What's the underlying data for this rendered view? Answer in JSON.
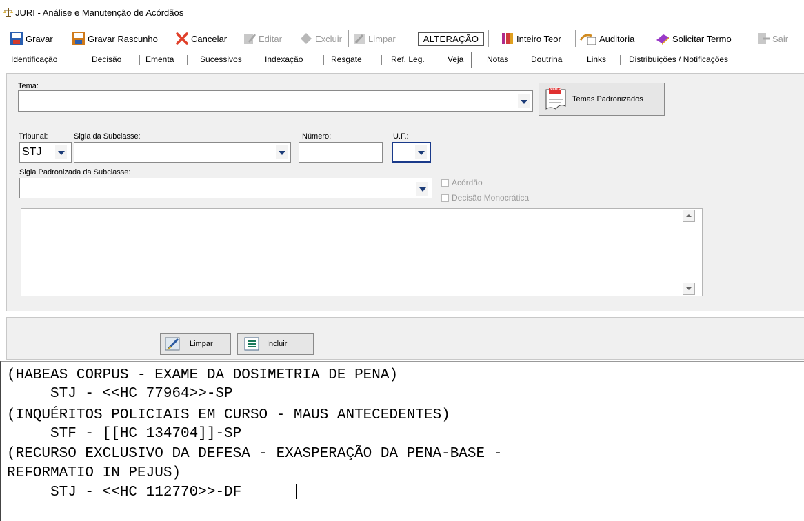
{
  "window": {
    "title": "JURI - Análise e Manutenção de Acórdãos"
  },
  "toolbar": {
    "gravar": {
      "pre": "",
      "u": "G",
      "post": "ravar"
    },
    "gravar_rascunho": "Gravar Rascunho",
    "cancelar": {
      "pre": "",
      "u": "C",
      "post": "ancelar"
    },
    "editar": {
      "pre": "",
      "u": "E",
      "post": "ditar"
    },
    "excluir": {
      "pre": "E",
      "u": "x",
      "post": "cluir"
    },
    "limpar": {
      "pre": "",
      "u": "L",
      "post": "impar"
    },
    "mode": "ALTERAÇÃO",
    "inteiro_teor": {
      "pre": "",
      "u": "I",
      "post": "nteiro Teor"
    },
    "auditoria": {
      "pre": "Au",
      "u": "d",
      "post": "itoria"
    },
    "solicitar_termo": {
      "pre": "Solicitar ",
      "u": "T",
      "post": "ermo"
    },
    "sair": {
      "pre": "",
      "u": "S",
      "post": "air"
    }
  },
  "tabs": [
    {
      "pre": "",
      "u": "I",
      "post": "dentificação"
    },
    {
      "pre": "",
      "u": "D",
      "post": "ecisão"
    },
    {
      "pre": "",
      "u": "E",
      "post": "menta"
    },
    {
      "pre": "",
      "u": "S",
      "post": "ucessivos"
    },
    {
      "pre": "Inde",
      "u": "x",
      "post": "ação"
    },
    {
      "pre": "Res",
      "u": "g",
      "post": "ate"
    },
    {
      "pre": "",
      "u": "R",
      "post": "ef. Leg."
    },
    {
      "pre": "",
      "u": "V",
      "post": "eja"
    },
    {
      "pre": "",
      "u": "N",
      "post": "otas"
    },
    {
      "pre": "D",
      "u": "o",
      "post": "utrina"
    },
    {
      "pre": "",
      "u": "L",
      "post": "inks"
    },
    {
      "pre": "Distribuições / Notificações",
      "u": "",
      "post": ""
    }
  ],
  "form": {
    "tema_label": "Tema:",
    "tema_value": "",
    "temas_button": "Temas Padronizados",
    "nota_badge": "NOTA",
    "tribunal_label": "Tribunal:",
    "tribunal_value": "STJ",
    "sigla_label": "Sigla da Subclasse:",
    "sigla_value": "",
    "numero_label": "Número:",
    "numero_value": "",
    "uf_label": "U.F.:",
    "uf_value": "",
    "sigla_padronizada_label": "Sigla Padronizada da Subclasse:",
    "sigla_padronizada_value": "",
    "acordao_label": "Acórdão",
    "decisao_mono_label": "Decisão Monocrática"
  },
  "actions": {
    "limpar": "Limpar",
    "incluir": "Incluir"
  },
  "editor": {
    "lines": [
      "(HABEAS CORPUS - EXAME DA DOSIMETRIA DE PENA)",
      "     STJ - <<HC 77964>>-SP",
      "(INQUÉRITOS POLICIAIS EM CURSO - MAUS ANTECEDENTES)",
      "     STF - [[HC 134704]]-SP",
      "(RECURSO EXCLUSIVO DA DEFESA - EXASPERAÇÃO DA PENA-BASE -",
      "REFORMATIO IN PEJUS)",
      "     STJ - <<HC 112770>>-DF"
    ]
  }
}
